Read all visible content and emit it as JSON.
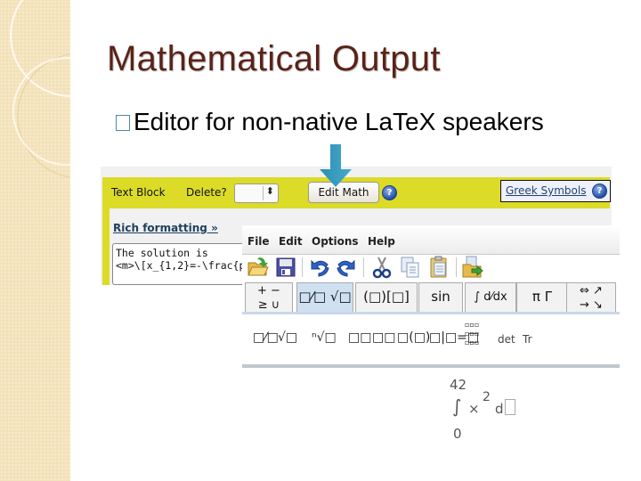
{
  "slide": {
    "title": "Mathematical Output",
    "bullet": "Editor for non-native La​Te​X speakers"
  },
  "web_editor": {
    "text_block_label": "Text Block",
    "delete_label": "Delete?",
    "delete_select_value": "",
    "edit_math_button": "Edit Math",
    "help_icon": "?",
    "greek_symbols_link": "Greek Symbols",
    "rich_formatting_link": "Rich formatting »",
    "textarea_value": "The solution is\n<m>\\[x_{1,2}=-\\frac{p",
    "colors": {
      "toolbar": "#dcdb27",
      "link": "#22446f"
    }
  },
  "math_editor": {
    "menu": [
      "File",
      "Edit",
      "Options",
      "Help"
    ],
    "toolbar_icons": [
      "open-folder-icon",
      "save-icon",
      "undo-icon",
      "redo-icon",
      "cut-icon",
      "copy-icon",
      "paste-icon",
      "export-icon"
    ],
    "tabs": [
      {
        "line1": "+ −",
        "line2": "≥ ∪",
        "active": false
      },
      {
        "line1": "□⁄□ √□",
        "line2": "",
        "active": true
      },
      {
        "line1": "(□)[□]",
        "line2": "",
        "active": false
      },
      {
        "line1": "sin",
        "line2": "",
        "active": false
      },
      {
        "line1": "∫ d⁄dx",
        "line2": "",
        "active": false
      },
      {
        "line1": "π Γ",
        "line2": "",
        "active": false
      },
      {
        "line1": "⇔ ↗",
        "line2": "→ ↘",
        "active": false
      }
    ],
    "palette": {
      "fraction": "□⁄□",
      "sqrt": "√□",
      "nth_root": "ⁿ√□",
      "superscript": "□□",
      "subscript": "□□",
      "function": "□(□)",
      "evaluated_at": "□|□=□",
      "matrix": "▫▫▫\n▫▫▫\n▫▫▫",
      "det": "det",
      "trace": "Tr"
    },
    "formula": {
      "upper_limit": "42",
      "integral": "∫",
      "integrand": "×",
      "exponent": "2",
      "differential": "d",
      "lower_limit": "0"
    }
  }
}
